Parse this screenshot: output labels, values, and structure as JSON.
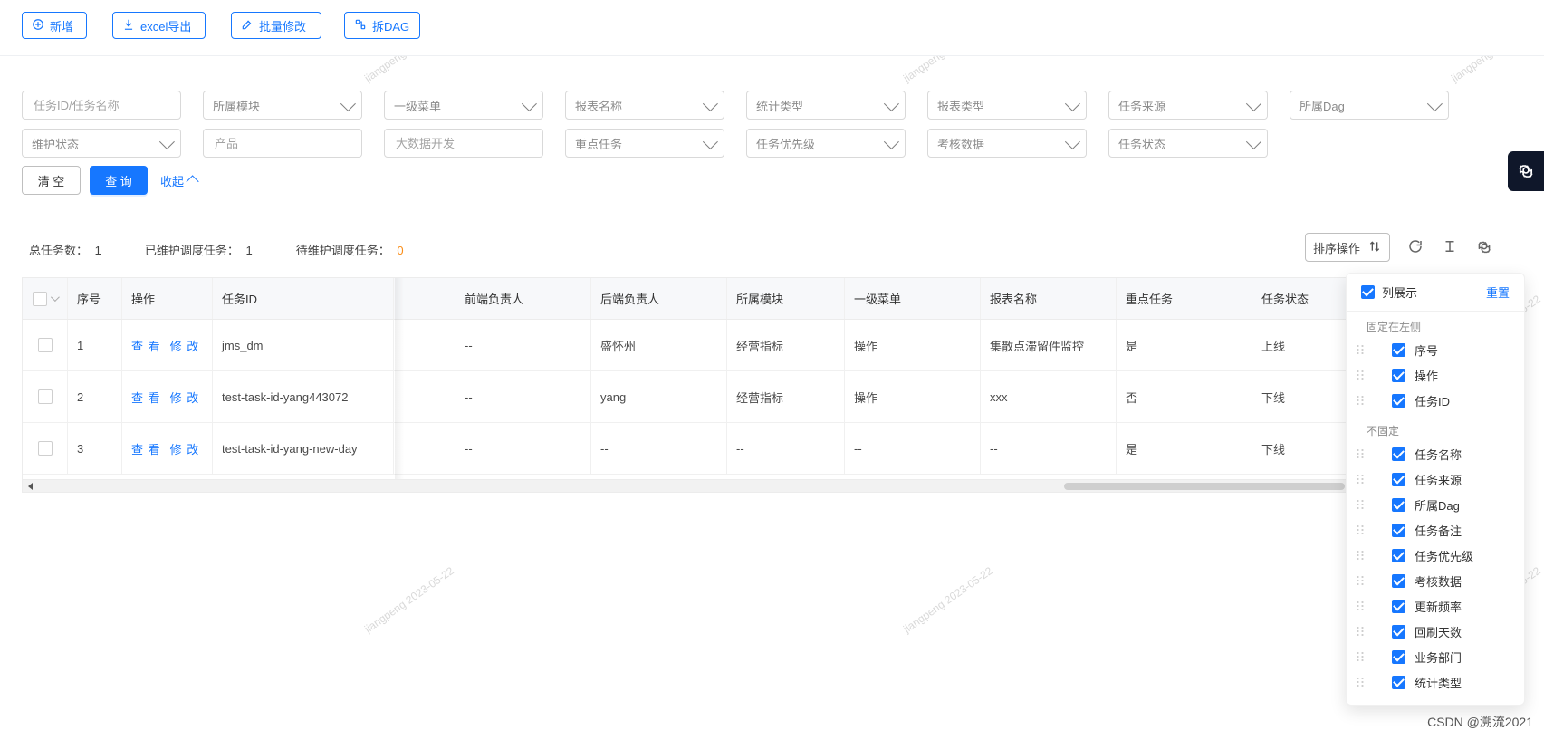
{
  "toolbar": {
    "add_label": "新增",
    "export_label": "excel导出",
    "batch_edit_label": "批量修改",
    "split_dag_label": "拆DAG"
  },
  "filters": {
    "placeholders": {
      "task_id_name": "任务ID/任务名称",
      "module": "所属模块",
      "menu_level1": "一级菜单",
      "report_name": "报表名称",
      "stat_type": "统计类型",
      "report_type": "报表类型",
      "task_source": "任务来源",
      "dag": "所属Dag",
      "maintain_status": "维护状态",
      "product": "产品",
      "bigdata_dev": "大数据开发",
      "key_task": "重点任务",
      "task_priority": "任务优先级",
      "assessment": "考核数据",
      "task_status": "任务状态"
    },
    "actions": {
      "clear": "清 空",
      "query": "查 询",
      "collapse": "收起"
    }
  },
  "stats": {
    "total_label": "总任务数：",
    "total_value": "1",
    "maintained_label": "已维护调度任务：",
    "maintained_value": "1",
    "pending_label": "待维护调度任务：",
    "pending_value": "0"
  },
  "table_tools": {
    "sort_label": "排序操作"
  },
  "table": {
    "headers": {
      "seq": "序号",
      "actions": "操作",
      "task_id": "任务ID",
      "frontend_owner": "前端负责人",
      "backend_owner": "后端负责人",
      "module": "所属模块",
      "menu_level1": "一级菜单",
      "report_name": "报表名称",
      "key_task": "重点任务",
      "task_status": "任务状态"
    },
    "rows": [
      {
        "seq": "1",
        "view": "查 看",
        "edit": "修 改",
        "task_id": "jms_dm",
        "frontend_owner": "--",
        "backend_owner": "盛怀州",
        "module": "经营指标",
        "menu_level1": "操作",
        "report_name": "集散点滞留件监控",
        "key_task": "是",
        "task_status": "上线"
      },
      {
        "seq": "2",
        "view": "查 看",
        "edit": "修 改",
        "task_id": "test-task-id-yang443072",
        "frontend_owner": "--",
        "backend_owner": "yang",
        "module": "经营指标",
        "menu_level1": "操作",
        "report_name": "xxx",
        "key_task": "否",
        "task_status": "下线"
      },
      {
        "seq": "3",
        "view": "查 看",
        "edit": "修 改",
        "task_id": "test-task-id-yang-new-day",
        "frontend_owner": "--",
        "backend_owner": "--",
        "module": "--",
        "menu_level1": "--",
        "report_name": "--",
        "key_task": "是",
        "task_status": "下线"
      }
    ]
  },
  "column_panel": {
    "title": "列展示",
    "reset": "重置",
    "fixed_left_title": "固定在左侧",
    "fixed_left": [
      "序号",
      "操作",
      "任务ID"
    ],
    "unfixed_title": "不固定",
    "unfixed": [
      "任务名称",
      "任务来源",
      "所属Dag",
      "任务备注",
      "任务优先级",
      "考核数据",
      "更新频率",
      "回刷天数",
      "业务部门",
      "统计类型"
    ]
  },
  "watermark": {
    "text": "jiangpeng 2023-05-22"
  },
  "footer": {
    "csdn": "CSDN @溯流2021"
  },
  "colors": {
    "primary": "#1677ff",
    "orange": "#fa8c16",
    "dark": "#0f172a"
  },
  "icons": {
    "plus": "plus-circle-icon",
    "export": "download-icon",
    "batch": "edit-icon",
    "split": "split-icon",
    "refresh": "refresh-icon",
    "density": "text-height-icon",
    "settings": "gear-icon",
    "sort": "sort-icon"
  }
}
